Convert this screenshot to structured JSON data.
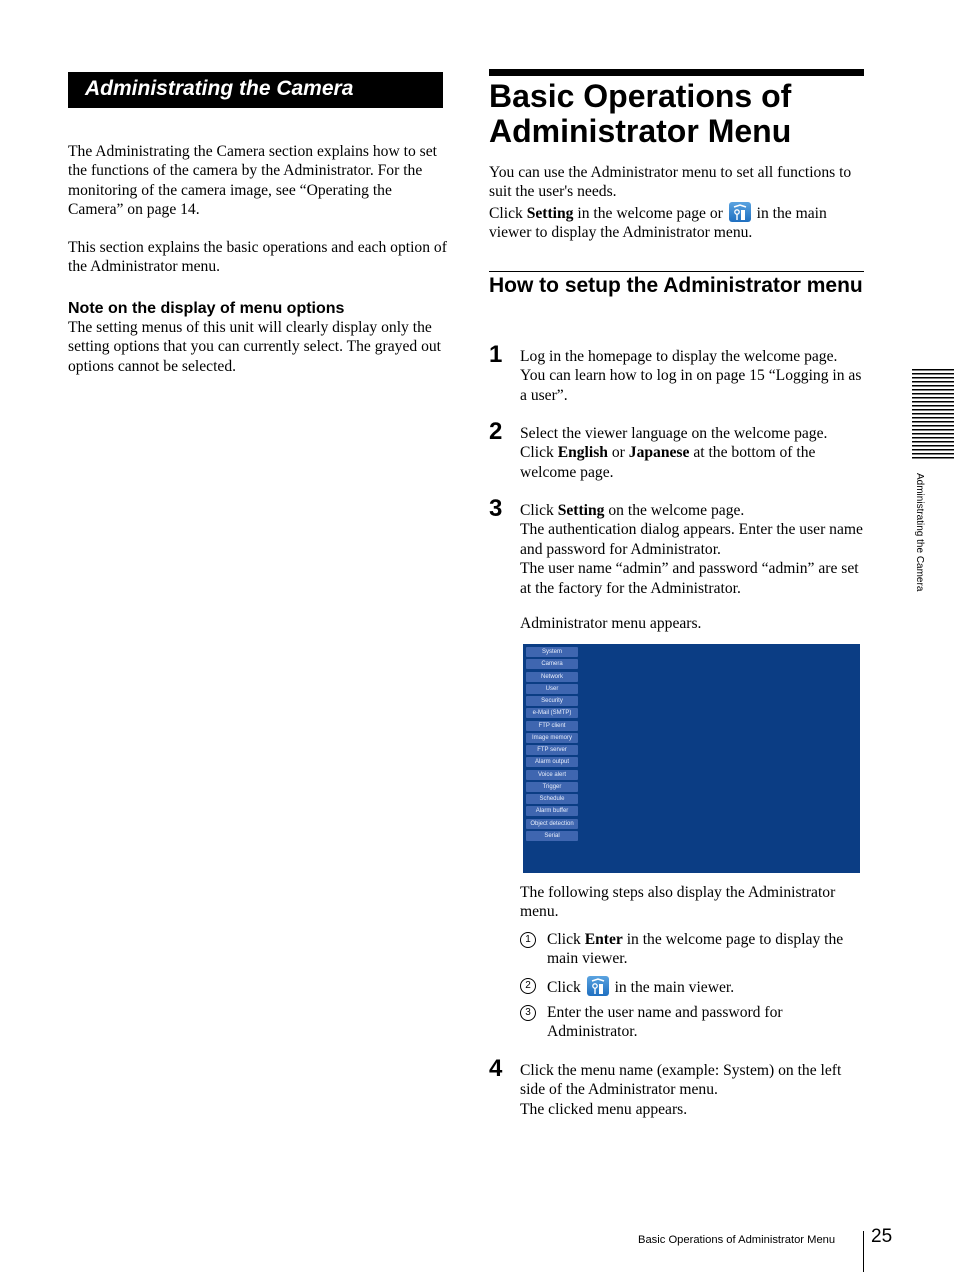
{
  "left": {
    "banner_title": "Administrating the Camera",
    "paragraphs": [
      "The Administrating the Camera section explains how to set the functions of the camera by the Administrator. For the monitoring of the camera image, see “Operating the Camera” on page 14.",
      "This section explains the basic operations and each option of the Administrator menu."
    ],
    "note": {
      "heading": "Note on the display of menu options",
      "body": "The setting menus of this unit will clearly display only the setting options that you can currently select. The grayed out options cannot be selected."
    }
  },
  "right": {
    "title": "Basic Operations of Administrator Menu",
    "intro": {
      "line1": "You can use the Administrator menu to set all functions to suit the user's needs.",
      "click": "Click ",
      "setting": "Setting",
      "mid": " in the welcome page or ",
      "icon": "admin-setting-icon",
      "end": " in the main viewer to display the Administrator menu."
    },
    "section_title": "How to setup the Administrator menu",
    "steps": [
      {
        "num": "1",
        "text": "Log in the homepage to display the welcome page. You can learn how to log in on page 15 “Logging in as a user”."
      },
      {
        "num": "2",
        "pre": "Select the viewer language on the welcome page. Click ",
        "b1": "English",
        "mid": " or ",
        "b2": "Japanese",
        "post": " at the bottom of the welcome page."
      },
      {
        "num": "3",
        "pre": "Click ",
        "b1": "Setting",
        "post": " on the welcome page.",
        "line2": "The authentication dialog appears. Enter the user name and password for Administrator.",
        "line3": "The user name “admin” and password “admin” are set at the factory for the Administrator.",
        "after": "Administrator menu appears."
      },
      {
        "num": "4",
        "text": "Click the menu name (example: System) on the left side of the Administrator menu.",
        "line2": "The clicked menu appears."
      }
    ],
    "admin_menu_items": [
      "System",
      "Camera",
      "Network",
      "User",
      "Security",
      "e-Mail (SMTP)",
      "FTP client",
      "Image memory",
      "FTP server",
      "Alarm output",
      "Voice alert",
      "Trigger",
      "Schedule",
      "Alarm buffer",
      "Object detection",
      "Serial"
    ],
    "following": "The following steps also display the Administrator menu.",
    "sub_steps": [
      {
        "num": "1",
        "pre": "Click ",
        "bold": "Enter",
        "post": " in the welcome page to display the main viewer."
      },
      {
        "num": "2",
        "pre": "Click ",
        "icon": "admin-setting-icon",
        "post": " in the main viewer."
      },
      {
        "num": "3",
        "text": "Enter the user name and password for Administrator."
      }
    ]
  },
  "side_tab": {
    "label": "Administrating the Camera"
  },
  "footer": {
    "section": "Basic Operations of Administrator Menu",
    "page": "25"
  },
  "colors": {
    "admin_bg": "#0b3d84",
    "admin_button": "#3f66b0"
  }
}
